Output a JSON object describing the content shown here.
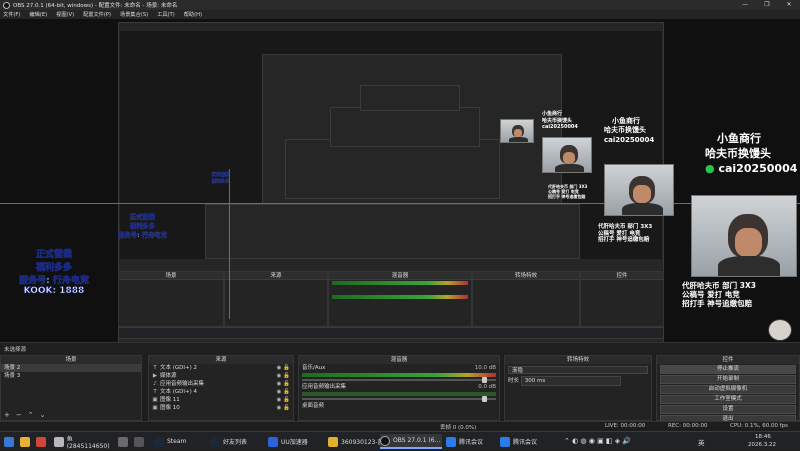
{
  "window": {
    "title": "OBS 27.0.1 (64-bit, windows) - 配置文件: 未命名 - 场景: 未命名",
    "controls": [
      "—",
      "❐",
      "✕"
    ]
  },
  "menu": [
    "文件(F)",
    "编辑(E)",
    "视图(V)",
    "配置文件(P)",
    "场景集合(S)",
    "工具(T)",
    "帮助(H)"
  ],
  "overlay": {
    "sticker": {
      "line1": "正式營業",
      "line2": "福利多多",
      "line3": "服务号: 行舟电竞",
      "line4": "KOOK: 1888"
    },
    "shop": {
      "name": "小鱼商行",
      "slogan": "哈夫币换馒头",
      "wechat": "cai20250004"
    },
    "ad": {
      "line1": "代肝哈夫币 部门 3X3",
      "line2": "公稿号 爱打 电竞",
      "line3": "招打手 神号追缴包赔"
    }
  },
  "scenes_header": "未选择源",
  "scenes": {
    "title": "场景",
    "items": [
      "场景 2",
      "场景 3"
    ]
  },
  "sources": {
    "title": "来源",
    "items": [
      "文本 (GDI+) 2",
      "媒体源",
      "应用音频输出采集",
      "文本 (GDI+) 4",
      "图像 11",
      "图像 10"
    ]
  },
  "mixer": {
    "title": "混音器",
    "ch1": {
      "name": "音乐/Aux",
      "db": "10.0 dB"
    },
    "ch2": {
      "name": "应用音频输出采集",
      "db": "0.0 dB"
    },
    "ch3": {
      "name": "桌面音频"
    }
  },
  "transition": {
    "title": "转场特效",
    "type": "渐隐",
    "duration_label": "时长",
    "duration": "300 ms"
  },
  "controls": {
    "title": "控件",
    "buttons": [
      "停止推流",
      "开始录制",
      "启动虚拟摄像机",
      "工作室模式",
      "设置",
      "退出"
    ]
  },
  "status": {
    "live": "LIVE: 00:00:00",
    "rec": "REC: 00:00:00",
    "cpu": "CPU: 0.1%, 60.00 fps",
    "frames": "丢帧 0 (0.0%)"
  },
  "taskbar": {
    "items": [
      "鱼(2845114650)",
      "Steam",
      "好友列表",
      "UU加速器",
      "360930123-蓝",
      "OBS 27.0.1 (6...",
      "腾讯会议",
      "腾讯会议"
    ],
    "time": "18:46",
    "date": "2026.3.22",
    "lang": "英"
  },
  "colors": {
    "accent": "#3a6ef0",
    "meter_green": "#3aa33a",
    "meter_red": "#b03030",
    "stop_button": "#484848"
  }
}
